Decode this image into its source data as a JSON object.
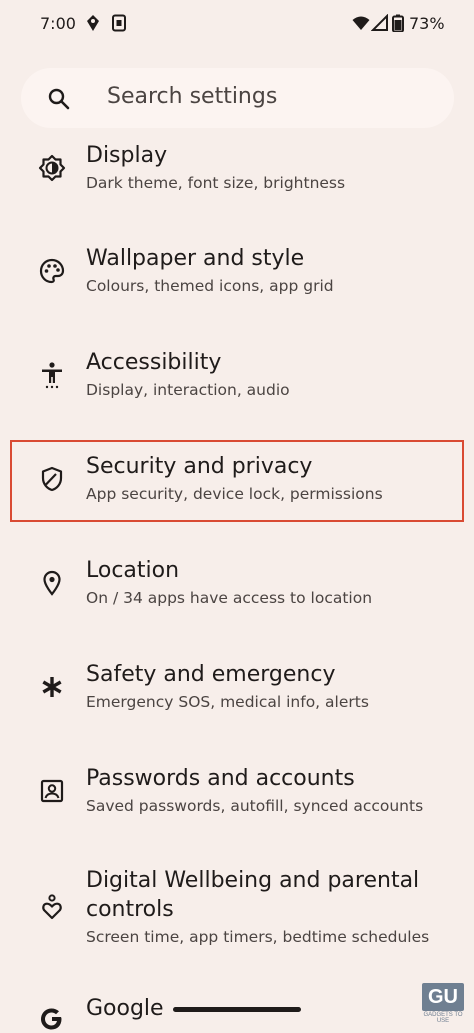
{
  "status_bar": {
    "time": "7:00",
    "battery_percent": "73%",
    "icons": [
      "location-icon",
      "sim-icon",
      "wifi-icon",
      "signal-icon",
      "battery-icon"
    ]
  },
  "search": {
    "placeholder": "Search settings",
    "icon": "search-icon"
  },
  "settings_items": [
    {
      "title": "Display",
      "subtitle": "Dark theme, font size, brightness",
      "icon": "brightness-icon"
    },
    {
      "title": "Wallpaper and style",
      "subtitle": "Colours, themed icons, app grid",
      "icon": "palette-icon"
    },
    {
      "title": "Accessibility",
      "subtitle": "Display, interaction, audio",
      "icon": "accessibility-icon"
    },
    {
      "title": "Security and privacy",
      "subtitle": "App security, device lock, permissions",
      "icon": "shield-icon"
    },
    {
      "title": "Location",
      "subtitle": "On / 34 apps have access to location",
      "icon": "location-pin-icon"
    },
    {
      "title": "Safety and emergency",
      "subtitle": "Emergency SOS, medical info, alerts",
      "icon": "asterisk-icon"
    },
    {
      "title": "Passwords and accounts",
      "subtitle": "Saved passwords, autofill, synced accounts",
      "icon": "account-box-icon"
    },
    {
      "title_line1": "Digital Wellbeing and parental",
      "title_line2": "controls",
      "subtitle": "Screen time, app timers, bedtime schedules",
      "icon": "wellbeing-icon"
    },
    {
      "title": "Google",
      "icon": "google-icon"
    }
  ],
  "highlight_color": "#d94a33",
  "watermark": {
    "logo": "GU",
    "text": "GADGETS TO USE"
  }
}
